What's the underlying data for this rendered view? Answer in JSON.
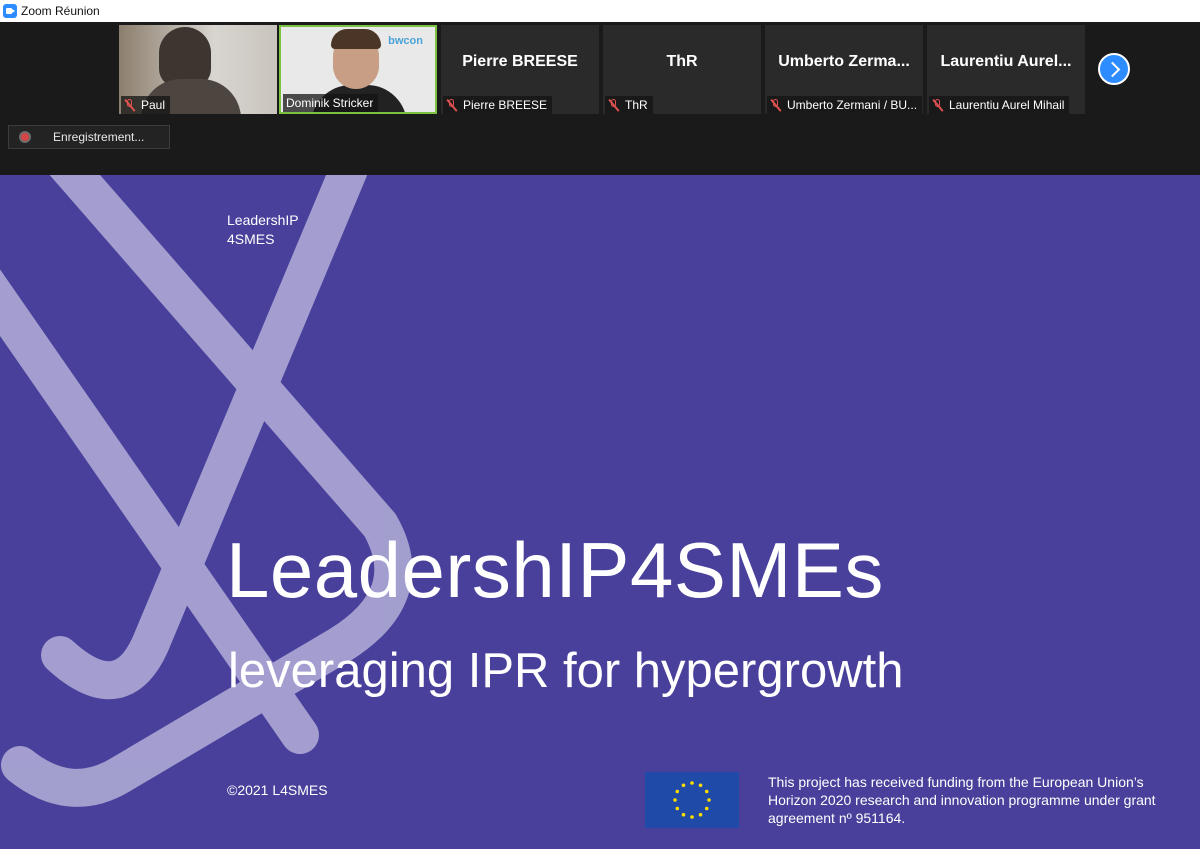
{
  "window": {
    "title": "Zoom Réunion",
    "icon": "zoom-camera-icon"
  },
  "participants": [
    {
      "label": "Paul",
      "big_name": "",
      "muted": true,
      "has_video": true
    },
    {
      "label": "Dominik Stricker",
      "big_name": "",
      "muted": false,
      "has_video": true,
      "active_speaker": true,
      "background_logo": "bwcon"
    },
    {
      "label": "Pierre BREESE",
      "big_name": "Pierre BREESE",
      "muted": true,
      "has_video": false
    },
    {
      "label": "ThR",
      "big_name": "ThR",
      "muted": true,
      "has_video": false
    },
    {
      "label": "Umberto Zermani / BU...",
      "big_name": "Umberto  Zerma...",
      "muted": true,
      "has_video": false
    },
    {
      "label": "Laurentiu Aurel Mihail",
      "big_name": "Laurentiu  Aurel...",
      "muted": true,
      "has_video": false
    }
  ],
  "recording": {
    "label": "Enregistrement..."
  },
  "slide": {
    "brand_line1": "LeadershIP",
    "brand_line2": "4SMES",
    "headline": "LeadershIP4SMEs",
    "subline": "leveraging IPR for hypergrowth",
    "copyright": "©2021 L4SMES",
    "funding": "This project has received funding from the European Union’s Horizon 2020 research and innovation programme under grant agreement nº 951164.",
    "background_color": "#48409b"
  },
  "colors": {
    "accent": "#2d8cff",
    "active_speaker": "#7bc142",
    "muted": "#e0524f"
  }
}
